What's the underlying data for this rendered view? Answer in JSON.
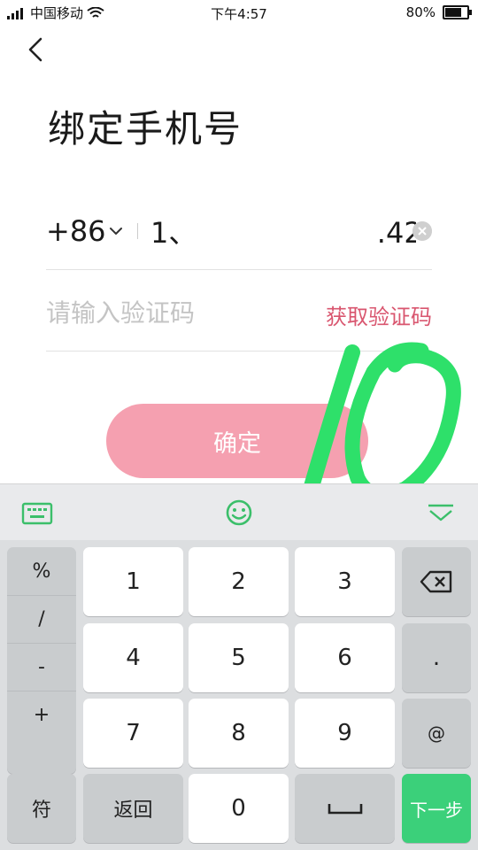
{
  "status_bar": {
    "carrier": "中国移动",
    "time": "下午4:57",
    "battery": "80%",
    "battery_level": 0.8
  },
  "header": {
    "back_icon": "chevron-left-icon",
    "title": "绑定手机号"
  },
  "phone": {
    "country_code": "+86",
    "value": "1、                    .42",
    "clear_icon": "clear-circle-icon"
  },
  "verify": {
    "placeholder": "请输入验证码",
    "get_code_label": "获取验证码"
  },
  "confirm_label": "确定",
  "annotation_text": "10",
  "keyboard": {
    "toolbar_icons": [
      "keyboard-icon",
      "emoji-icon",
      "collapse-icon"
    ],
    "symbols": [
      "%",
      "/",
      "-",
      "+"
    ],
    "digits": [
      "1",
      "2",
      "3",
      "4",
      "5",
      "6",
      "7",
      "8",
      "9",
      "0"
    ],
    "dot": ".",
    "at": "@",
    "fu": "符",
    "back_label": "返回",
    "next_label": "下一步",
    "space_icon": "space-icon",
    "backspace_icon": "backspace-icon"
  },
  "colors": {
    "accent_pink": "#f5a0b0",
    "link_red": "#d9566f",
    "keyboard_green": "#3bd07a",
    "annotation_green": "#2ee06a"
  }
}
